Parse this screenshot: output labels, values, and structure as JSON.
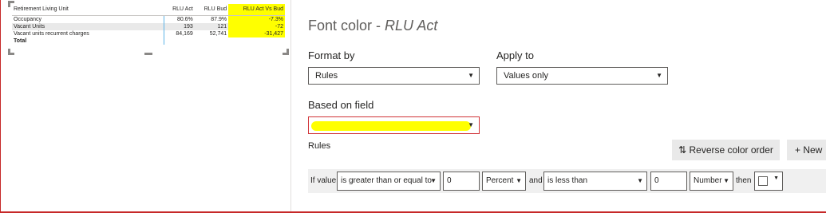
{
  "table": {
    "headers": [
      "Retirement Living Unit",
      "RLU Act",
      "RLU Bud",
      "RLU Act Vs Bud"
    ],
    "rows": [
      {
        "label": "Occupancy",
        "act": "80.6%",
        "bud": "87.9%",
        "diff": "-7.3%"
      },
      {
        "label": "Vacant Units",
        "act": "193",
        "bud": "121",
        "diff": "-72"
      },
      {
        "label": "Vacant units recurrent charges",
        "act": "84,169",
        "bud": "52,741",
        "diff": "-31,427"
      }
    ],
    "total_label": "Total"
  },
  "pane": {
    "title_prefix": "Font color - ",
    "title_field": "RLU Act",
    "format_by_label": "Format by",
    "format_by_value": "Rules",
    "apply_to_label": "Apply to",
    "apply_to_value": "Values only",
    "based_on_label": "Based on field",
    "based_on_value": "",
    "rules_label": "Rules",
    "reverse_button": "Reverse color order",
    "new_button": "New",
    "rule": {
      "if_value": "If value",
      "op1": "is greater than or equal to",
      "val1": "0",
      "type1": "Percent",
      "and": "and",
      "op2": "is less than",
      "val2": "0",
      "type2": "Number",
      "then": "then"
    }
  },
  "colors": {
    "highlight": "#ffff00",
    "frame": "#c62828",
    "field_error": "#d13438"
  }
}
